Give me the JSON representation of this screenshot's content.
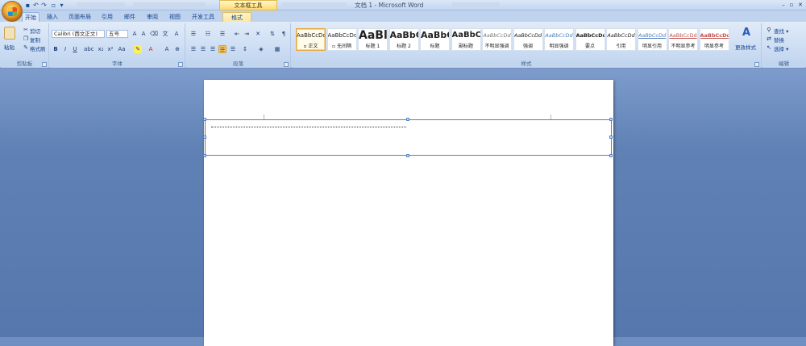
{
  "titlebar": {
    "window_title": "文档 1 - Microsoft Word",
    "context_tools": "文本框工具"
  },
  "tabs": [
    "开始",
    "插入",
    "页面布局",
    "引用",
    "邮件",
    "审阅",
    "视图",
    "开发工具",
    "格式"
  ],
  "clipboard": {
    "paste": "粘贴",
    "cut": "剪切",
    "copy": "复制",
    "format_painter": "格式刷",
    "label": "剪贴板"
  },
  "font": {
    "name": "Calibri (西文正文)",
    "size": "五号",
    "label": "字体"
  },
  "paragraph": {
    "label": "段落"
  },
  "styles": {
    "label": "样式",
    "items": [
      {
        "sample": "AaBbCcDd",
        "name": "▫ 正文"
      },
      {
        "sample": "AaBbCcDd",
        "name": "▫ 无间隔"
      },
      {
        "sample": "AaBl",
        "name": "标题 1"
      },
      {
        "sample": "AaBbC",
        "name": "标题 2"
      },
      {
        "sample": "AaBbC",
        "name": "标题"
      },
      {
        "sample": "AaBbC",
        "name": "副标题"
      },
      {
        "sample": "AaBbCcDd",
        "name": "不明显强调"
      },
      {
        "sample": "AaBbCcDd",
        "name": "强调"
      },
      {
        "sample": "AaBbCcDd",
        "name": "明显强调"
      },
      {
        "sample": "AaBbCcDd",
        "name": "要点"
      },
      {
        "sample": "AaBbCcDd",
        "name": "引用"
      },
      {
        "sample": "AaBbCcDd",
        "name": "明显引用"
      },
      {
        "sample": "AaBbCcDd",
        "name": "不明显参考"
      },
      {
        "sample": "AaBbCcDd",
        "name": "明显参考"
      }
    ],
    "change_styles": "更改样式"
  },
  "editing": {
    "find": "查找 ▾",
    "replace": "替换",
    "select": "选择 ▾",
    "label": "编辑"
  },
  "colors": {
    "ribbon": "#dbe7f6",
    "accent": "#15428b",
    "workspace": "#6385b8"
  }
}
